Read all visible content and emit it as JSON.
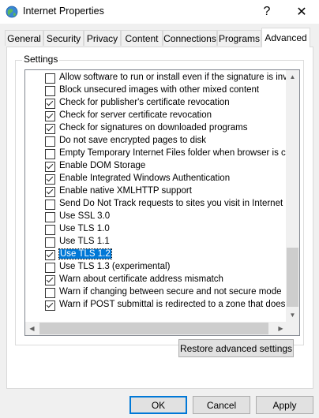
{
  "window": {
    "title": "Internet Properties",
    "help_glyph": "?",
    "close_glyph": "✕"
  },
  "tabs": [
    {
      "label": "General",
      "active": false
    },
    {
      "label": "Security",
      "active": false
    },
    {
      "label": "Privacy",
      "active": false
    },
    {
      "label": "Content",
      "active": false
    },
    {
      "label": "Connections",
      "active": false
    },
    {
      "label": "Programs",
      "active": false
    },
    {
      "label": "Advanced",
      "active": true
    }
  ],
  "settings": {
    "group_label": "Settings",
    "items": [
      {
        "label": "Allow software to run or install even if the signature is inva",
        "checked": false
      },
      {
        "label": "Block unsecured images with other mixed content",
        "checked": false
      },
      {
        "label": "Check for publisher's certificate revocation",
        "checked": true
      },
      {
        "label": "Check for server certificate revocation",
        "checked": true
      },
      {
        "label": "Check for signatures on downloaded programs",
        "checked": true
      },
      {
        "label": "Do not save encrypted pages to disk",
        "checked": false
      },
      {
        "label": "Empty Temporary Internet Files folder when browser is clo",
        "checked": false
      },
      {
        "label": "Enable DOM Storage",
        "checked": true
      },
      {
        "label": "Enable Integrated Windows Authentication",
        "checked": true
      },
      {
        "label": "Enable native XMLHTTP support",
        "checked": true
      },
      {
        "label": "Send Do Not Track requests to sites you visit in Internet E",
        "checked": false
      },
      {
        "label": "Use SSL 3.0",
        "checked": false
      },
      {
        "label": "Use TLS 1.0",
        "checked": false
      },
      {
        "label": "Use TLS 1.1",
        "checked": false
      },
      {
        "label": "Use TLS 1.2",
        "checked": true,
        "selected": true
      },
      {
        "label": "Use TLS 1.3 (experimental)",
        "checked": false
      },
      {
        "label": "Warn about certificate address mismatch",
        "checked": true
      },
      {
        "label": "Warn if changing between secure and not secure mode",
        "checked": false
      },
      {
        "label": "Warn if POST submittal is redirected to a zone that does n",
        "checked": true
      }
    ]
  },
  "buttons": {
    "restore": "Restore advanced settings",
    "ok": "OK",
    "cancel": "Cancel",
    "apply": "Apply"
  },
  "icons": {
    "app": "internet-globe-icon",
    "scroll_up": "▲",
    "scroll_down": "▼",
    "scroll_left": "◀",
    "scroll_right": "▶"
  }
}
